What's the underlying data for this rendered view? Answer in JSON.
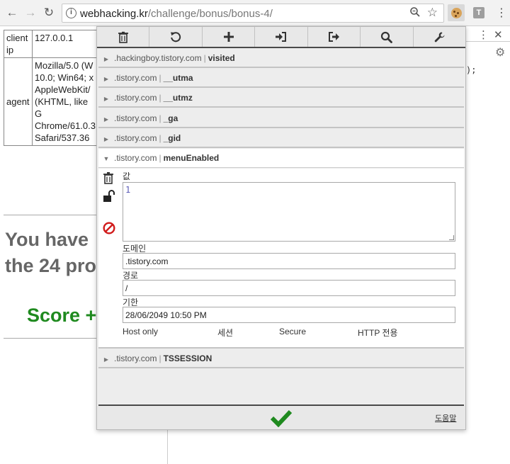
{
  "browser": {
    "back_glyph": "←",
    "forward_glyph": "→",
    "reload_glyph": "↻",
    "url_host": "webhacking.kr",
    "url_path": "/challenge/bonus/bonus-4/",
    "extensions": [
      "cookie-editor-icon",
      "t-extension-icon"
    ],
    "extension_t_label": "T"
  },
  "page": {
    "table": [
      {
        "key": "client ip",
        "value": "127.0.0.1"
      },
      {
        "key": "agent",
        "value": "Mozilla/5.0 (W 10.0; Win64; x AppleWebKit/ (KHTML, like G Chrome/61.0.3 Safari/537.36"
      }
    ],
    "heading_line1": "You have",
    "heading_line2": "the 24 pro",
    "score": "Score +",
    "devtools_code": ");"
  },
  "popup": {
    "actions": [
      {
        "icon": "trash-icon",
        "name": "delete-all-button"
      },
      {
        "icon": "undo-icon",
        "name": "reset-button"
      },
      {
        "icon": "plus-icon",
        "name": "add-cookie-button"
      },
      {
        "icon": "import-icon",
        "name": "import-button"
      },
      {
        "icon": "export-icon",
        "name": "export-button"
      },
      {
        "icon": "search-icon",
        "name": "search-button"
      },
      {
        "icon": "wrench-icon",
        "name": "options-button"
      }
    ],
    "cookies": [
      {
        "domain": ".hackingboy.tistory.com",
        "name": "visited",
        "expanded": false
      },
      {
        "domain": ".tistory.com",
        "name": "__utma",
        "expanded": false
      },
      {
        "domain": ".tistory.com",
        "name": "__utmz",
        "expanded": false
      },
      {
        "domain": ".tistory.com",
        "name": "_ga",
        "expanded": false
      },
      {
        "domain": ".tistory.com",
        "name": "_gid",
        "expanded": false
      },
      {
        "domain": ".tistory.com",
        "name": "menuEnabled",
        "expanded": true
      },
      {
        "domain": ".tistory.com",
        "name": "TSSESSION",
        "expanded": false
      }
    ],
    "separator": "|",
    "detail": {
      "value_label": "값",
      "value": "1",
      "domain_label": "도메인",
      "domain": ".tistory.com",
      "path_label": "경로",
      "path": "/",
      "expiry_label": "기한",
      "expiry": "28/06/2049 10:50 PM",
      "flags": [
        "Host only",
        "세션",
        "Secure",
        "HTTP 전용"
      ]
    },
    "help_label": "도움말",
    "colors": {
      "confirm": "#1f8a1f",
      "block": "#d11b1b"
    }
  }
}
